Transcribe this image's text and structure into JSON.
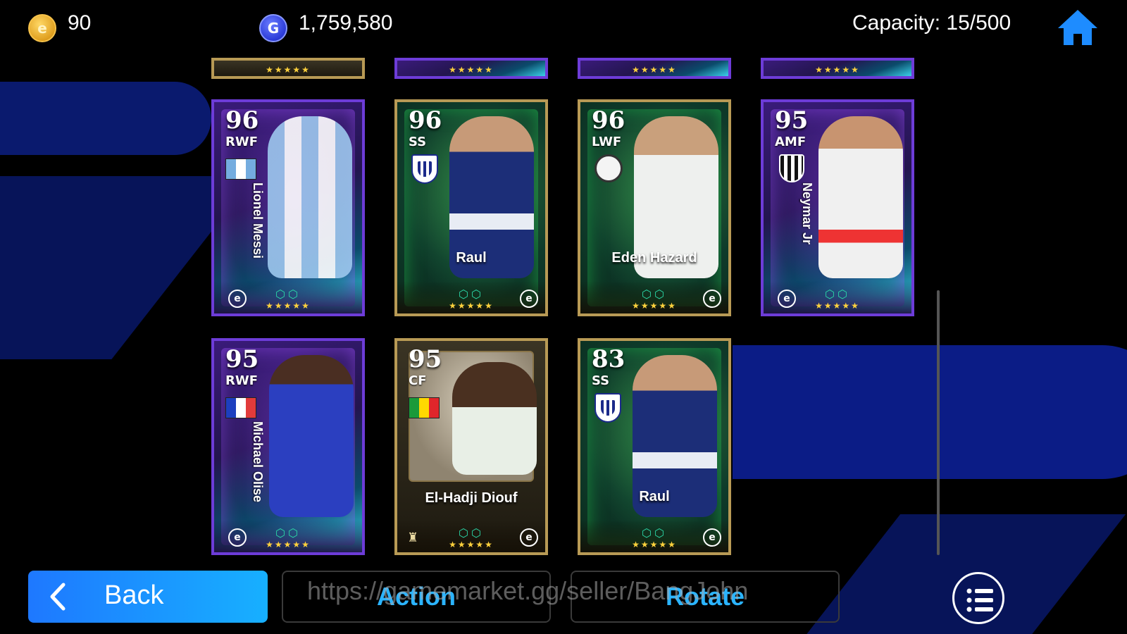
{
  "top_bar": {
    "coins_icon": "e-coin-icon",
    "coins": "90",
    "gp_icon": "gp-coin-icon",
    "gp": "1,759,580",
    "capacity": "Capacity: 15/500",
    "home_icon": "home-icon"
  },
  "cards": [
    {
      "rating": "96",
      "position": "RWF",
      "name": "Lionel Messi",
      "flag": "argentina"
    },
    {
      "rating": "96",
      "position": "SS",
      "name": "Raul"
    },
    {
      "rating": "96",
      "position": "LWF",
      "name": "Eden Hazard"
    },
    {
      "rating": "95",
      "position": "AMF",
      "name": "Neymar Jr"
    },
    {
      "rating": "95",
      "position": "RWF",
      "name": "Michael Olise",
      "flag": "france"
    },
    {
      "rating": "95",
      "position": "CF",
      "name": "El-Hadji Diouf",
      "flag": "senegal"
    },
    {
      "rating": "83",
      "position": "SS",
      "name": "Raul"
    }
  ],
  "card_stars": "★★★★★",
  "card_skills": "⬡⬡",
  "card_badge": "e",
  "buttons": {
    "back": "Back",
    "action": "Action",
    "rotate": "Rotate",
    "menu_icon": "list-menu-icon"
  },
  "watermark": "https://gamemarket.gg/seller/BangJohn",
  "colors": {
    "accent_blue": "#2bb4ff",
    "back_button": "#1e78ff",
    "star_gold": "#ffd23d"
  }
}
